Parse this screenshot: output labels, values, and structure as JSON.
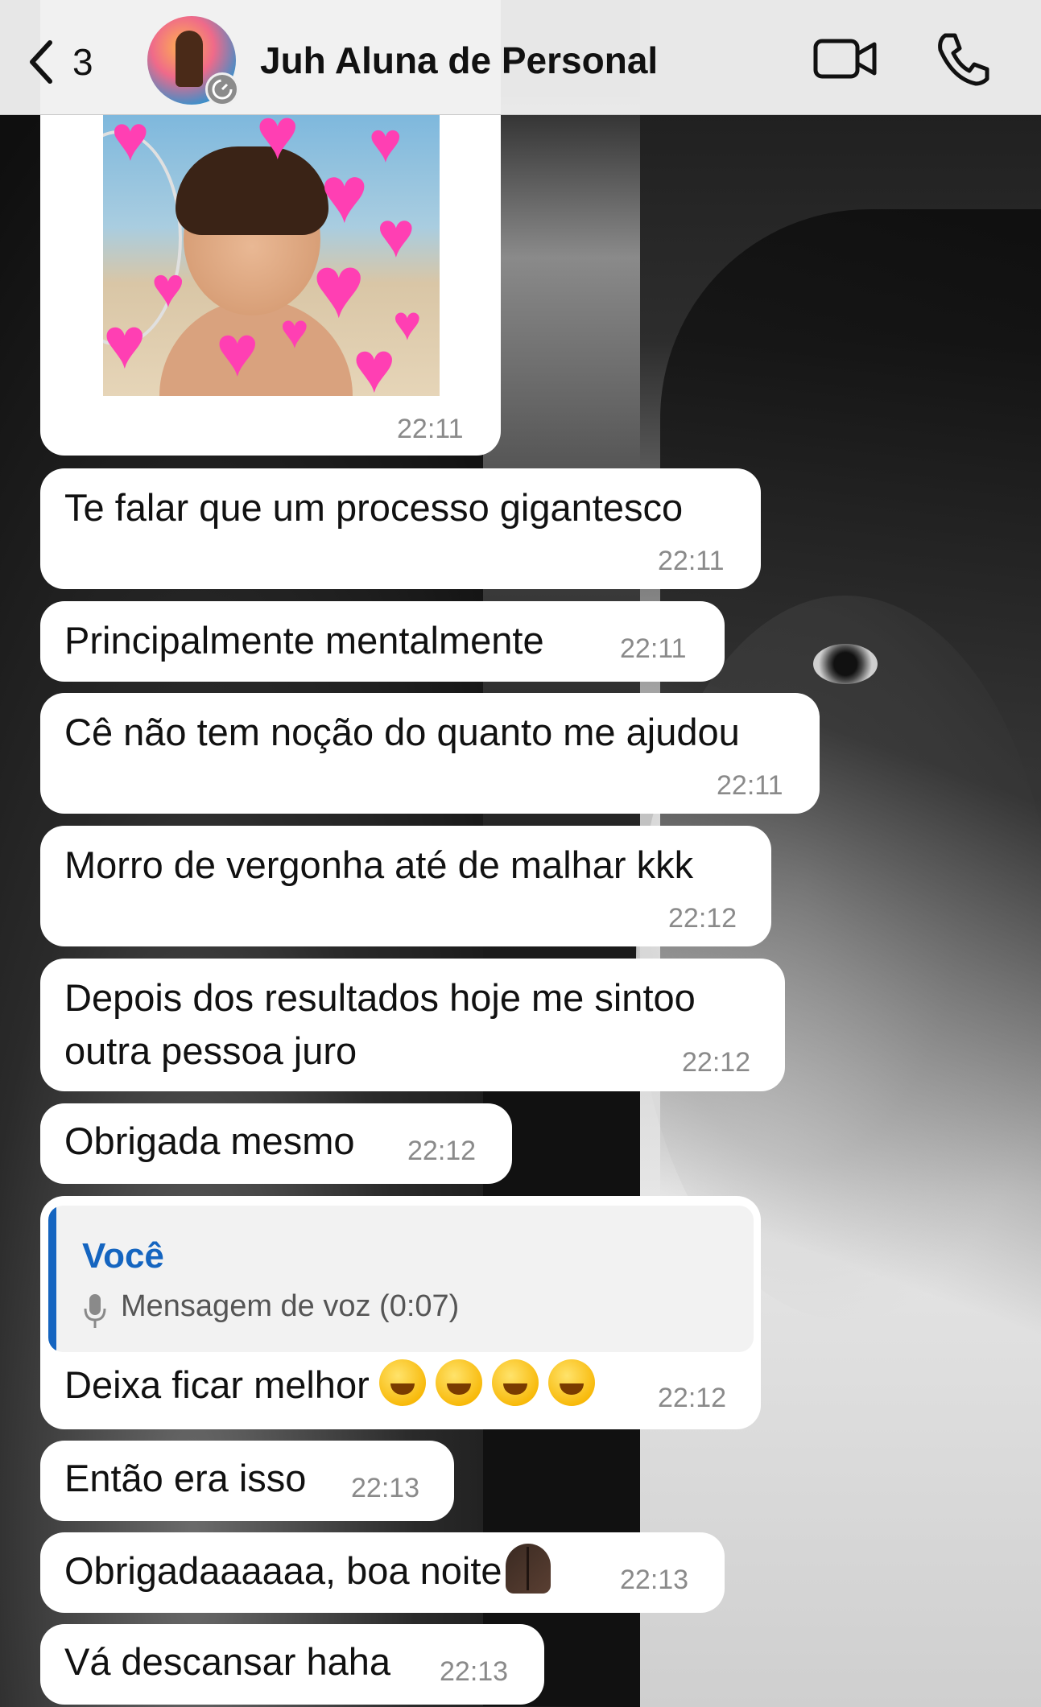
{
  "header": {
    "back_count": "3",
    "contact_name": "Juh Aluna de Personal"
  },
  "photo_message": {
    "time": "22:11"
  },
  "messages": [
    {
      "text": "Te falar que um processo gigantesco",
      "time": "22:11"
    },
    {
      "text": "Principalmente mentalmente",
      "time": "22:11"
    },
    {
      "text": "Cê não tem noção do quanto me ajudou",
      "time": "22:11"
    },
    {
      "text": "Morro de vergonha até de malhar kkk",
      "time": "22:12"
    },
    {
      "line1": "Depois dos resultados hoje me sintoo",
      "line2": "outra pessoa juro",
      "time": "22:12"
    },
    {
      "text": "Obrigada mesmo",
      "time": "22:12"
    },
    {
      "quote_author": "Você",
      "quote_text": "Mensagem de voz (0:07)",
      "text": "Deixa ficar melhor",
      "time": "22:12"
    },
    {
      "text": "Então era isso",
      "time": "22:13"
    },
    {
      "text": "Obrigadaaaaaa, boa noite",
      "time": "22:13"
    },
    {
      "text": "Vá descansar haha",
      "time": "22:13"
    }
  ],
  "colors": {
    "quote_accent": "#1565c0",
    "bubble": "#ffffff",
    "header": "#f0f0f0"
  },
  "icons": [
    "back-chevron-icon",
    "video-call-icon",
    "phone-call-icon",
    "microphone-icon",
    "rolling-laughing-emoji",
    "folded-hands-emoji"
  ]
}
